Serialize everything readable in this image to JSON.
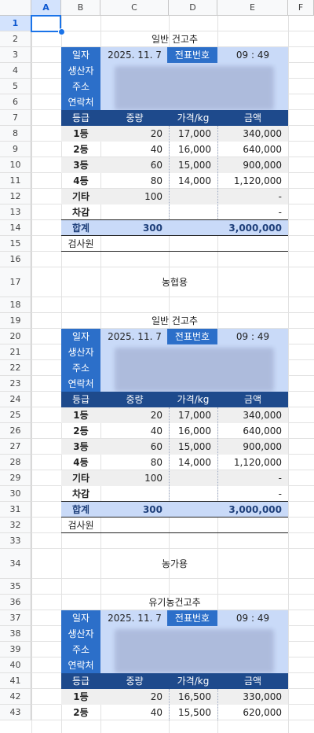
{
  "columns": [
    "A",
    "B",
    "C",
    "D",
    "E",
    "F"
  ],
  "rows": [
    "1",
    "2",
    "3",
    "4",
    "5",
    "6",
    "7",
    "8",
    "9",
    "10",
    "11",
    "12",
    "13",
    "14",
    "15",
    "16",
    "17",
    "18",
    "19",
    "20",
    "21",
    "22",
    "23",
    "24",
    "25",
    "26",
    "27",
    "28",
    "29",
    "30",
    "31",
    "32",
    "33",
    "34",
    "35",
    "36",
    "37",
    "38",
    "39",
    "40",
    "41",
    "42",
    "43"
  ],
  "active_cell": "A1",
  "colors": {
    "header_blue": "#2c6fc9",
    "table_header": "#1e4a8c",
    "light_blue": "#c9daf8",
    "selection": "#1a73e8"
  },
  "labels": {
    "date": "일자",
    "slip_no": "전표번호",
    "producer": "생산자",
    "address": "주소",
    "contact": "연락처",
    "grade": "등급",
    "weight": "중량",
    "price_kg": "가격/kg",
    "amount": "금액",
    "total": "합계",
    "inspector": "검사원"
  },
  "blocks": [
    {
      "title": "일반 건고추",
      "date": "2025. 11. 7",
      "time": "09 : 49",
      "rows": [
        {
          "grade": "1등",
          "weight": "20",
          "price": "17,000",
          "amount": "340,000"
        },
        {
          "grade": "2등",
          "weight": "40",
          "price": "16,000",
          "amount": "640,000"
        },
        {
          "grade": "3등",
          "weight": "60",
          "price": "15,000",
          "amount": "900,000"
        },
        {
          "grade": "4등",
          "weight": "80",
          "price": "14,000",
          "amount": "1,120,000"
        },
        {
          "grade": "기타",
          "weight": "100",
          "price": "",
          "amount": "-"
        },
        {
          "grade": "차감",
          "weight": "",
          "price": "",
          "amount": "-"
        }
      ],
      "total_weight": "300",
      "total_amount": "3,000,000",
      "footer": "농협용"
    },
    {
      "title": "일반 건고추",
      "date": "2025. 11. 7",
      "time": "09 : 49",
      "rows": [
        {
          "grade": "1등",
          "weight": "20",
          "price": "17,000",
          "amount": "340,000"
        },
        {
          "grade": "2등",
          "weight": "40",
          "price": "16,000",
          "amount": "640,000"
        },
        {
          "grade": "3등",
          "weight": "60",
          "price": "15,000",
          "amount": "900,000"
        },
        {
          "grade": "4등",
          "weight": "80",
          "price": "14,000",
          "amount": "1,120,000"
        },
        {
          "grade": "기타",
          "weight": "100",
          "price": "",
          "amount": "-"
        },
        {
          "grade": "차감",
          "weight": "",
          "price": "",
          "amount": "-"
        }
      ],
      "total_weight": "300",
      "total_amount": "3,000,000",
      "footer": "농가용"
    },
    {
      "title": "유기농건고추",
      "date": "2025. 11. 7",
      "time": "09 : 49",
      "rows": [
        {
          "grade": "1등",
          "weight": "20",
          "price": "16,500",
          "amount": "330,000"
        },
        {
          "grade": "2등",
          "weight": "40",
          "price": "15,500",
          "amount": "620,000"
        }
      ]
    }
  ]
}
